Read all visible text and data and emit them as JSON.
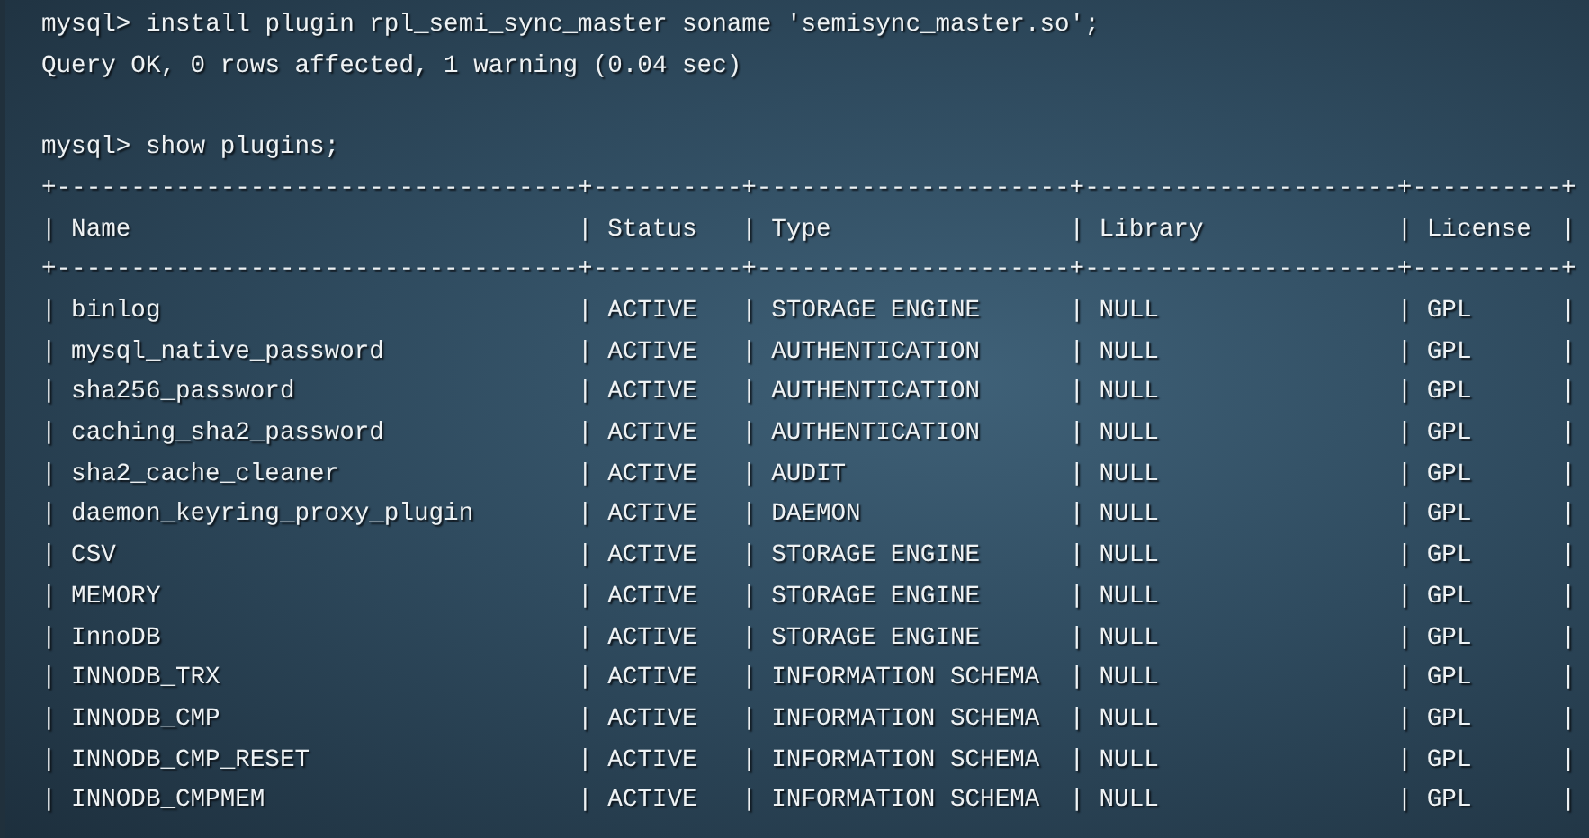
{
  "entries": [
    {
      "command": "mysql> install plugin rpl_semi_sync_master soname 'semisync_master.so';",
      "output": "Query OK, 0 rows affected, 1 warning (0.04 sec)"
    },
    {
      "command": "mysql> show plugins;",
      "table": {
        "top_border": "+-----------------------------------+----------+---------------------+---------------------+----------+",
        "header_rule": "+-----------------------------------+----------+---------------------+---------------------+----------+",
        "separator": "|",
        "columns": [
          "Name",
          "Status",
          "Type",
          "Library",
          "License"
        ],
        "rows": [
          [
            "binlog",
            "ACTIVE",
            "STORAGE ENGINE",
            "NULL",
            "GPL"
          ],
          [
            "mysql_native_password",
            "ACTIVE",
            "AUTHENTICATION",
            "NULL",
            "GPL"
          ],
          [
            "sha256_password",
            "ACTIVE",
            "AUTHENTICATION",
            "NULL",
            "GPL"
          ],
          [
            "caching_sha2_password",
            "ACTIVE",
            "AUTHENTICATION",
            "NULL",
            "GPL"
          ],
          [
            "sha2_cache_cleaner",
            "ACTIVE",
            "AUDIT",
            "NULL",
            "GPL"
          ],
          [
            "daemon_keyring_proxy_plugin",
            "ACTIVE",
            "DAEMON",
            "NULL",
            "GPL"
          ],
          [
            "CSV",
            "ACTIVE",
            "STORAGE ENGINE",
            "NULL",
            "GPL"
          ],
          [
            "MEMORY",
            "ACTIVE",
            "STORAGE ENGINE",
            "NULL",
            "GPL"
          ],
          [
            "InnoDB",
            "ACTIVE",
            "STORAGE ENGINE",
            "NULL",
            "GPL"
          ],
          [
            "INNODB_TRX",
            "ACTIVE",
            "INFORMATION SCHEMA",
            "NULL",
            "GPL"
          ],
          [
            "INNODB_CMP",
            "ACTIVE",
            "INFORMATION SCHEMA",
            "NULL",
            "GPL"
          ],
          [
            "INNODB_CMP_RESET",
            "ACTIVE",
            "INFORMATION SCHEMA",
            "NULL",
            "GPL"
          ],
          [
            "INNODB_CMPMEM",
            "ACTIVE",
            "INFORMATION SCHEMA",
            "NULL",
            "GPL"
          ]
        ]
      }
    }
  ]
}
